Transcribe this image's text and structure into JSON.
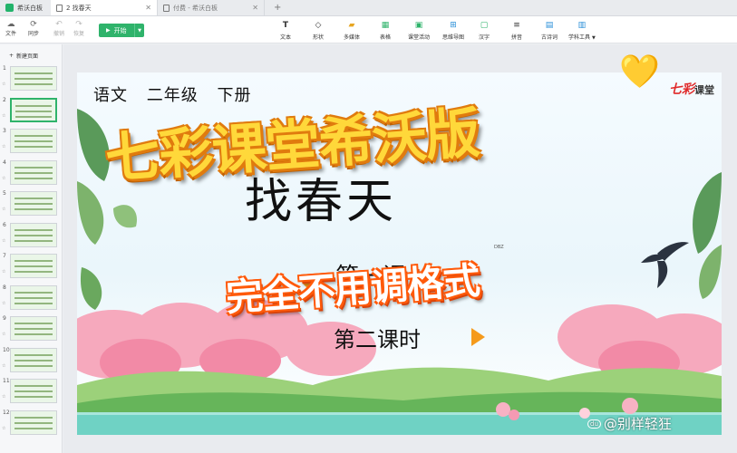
{
  "tabs": [
    {
      "label": "希沃白板",
      "icon": "whiteboard-logo-icon"
    },
    {
      "label": "2 找春天",
      "icon": "document-icon"
    },
    {
      "label": "付费 - 希沃白板",
      "icon": "document-icon"
    }
  ],
  "toolbar": {
    "file_label": "文件",
    "sync_label": "同步",
    "undo_label": "撤销",
    "redo_label": "恢复",
    "play_label": "开始",
    "tools": [
      "文本",
      "形状",
      "多媒体",
      "表格",
      "课堂活动",
      "思维导图",
      "汉字",
      "拼音",
      "古诗词",
      "学科工具"
    ]
  },
  "sidebar": {
    "new_page_label": "新建页面",
    "slide_numbers": [
      "1",
      "2",
      "3",
      "4",
      "5",
      "6",
      "7",
      "8",
      "9",
      "10",
      "11",
      "12"
    ],
    "active_slide": 2
  },
  "slide": {
    "grade_text": "语文 二年级 下册",
    "brand_mark": "七彩",
    "brand_text": "课堂",
    "title": "找春天",
    "lesson_number": "第一课",
    "lesson_period": "第二课时",
    "tiny_label": "DBZ"
  },
  "overlay": {
    "banner": "七彩课堂希沃版",
    "subbanner": "完全不用调格式",
    "heart": "💛",
    "watermark_badge": "du",
    "watermark": "@别样轻狂"
  },
  "colors": {
    "accent_green": "#2fb36b",
    "banner_yellow": "#ffd83a",
    "banner_orange": "#e07b0e",
    "sub_orange": "#ff5a0a"
  }
}
